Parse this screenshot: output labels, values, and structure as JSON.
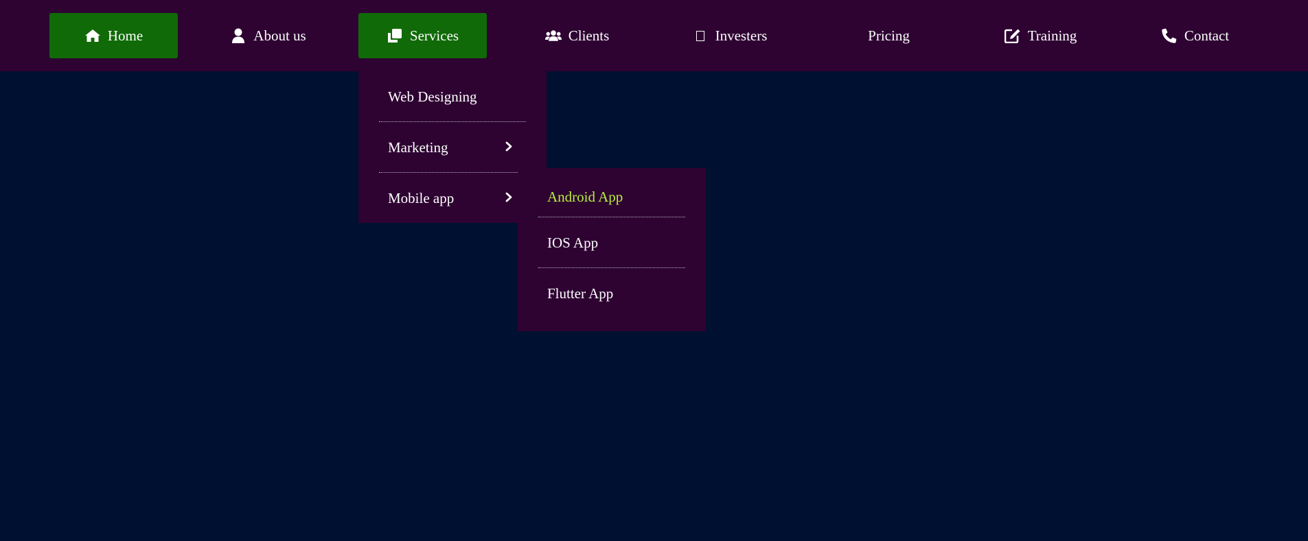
{
  "nav": {
    "items": [
      {
        "label": "Home",
        "icon": "home-icon",
        "active": true
      },
      {
        "label": "About us",
        "icon": "user-icon",
        "active": false
      },
      {
        "label": "Services",
        "icon": "clone-icon",
        "active": true
      },
      {
        "label": "Clients",
        "icon": "users-icon",
        "active": false
      },
      {
        "label": "Investers",
        "icon": "box-icon",
        "active": false
      },
      {
        "label": "Pricing",
        "icon": "",
        "active": false
      },
      {
        "label": "Training",
        "icon": "edit-icon",
        "active": false
      },
      {
        "label": "Contact",
        "icon": "phone-icon",
        "active": false
      }
    ]
  },
  "services_menu": {
    "items": [
      {
        "label": "Web Designing"
      },
      {
        "label": "Marketing"
      },
      {
        "label": "Mobile app"
      }
    ]
  },
  "mobile_submenu": {
    "items": [
      {
        "label": "Android App"
      },
      {
        "label": "IOS App"
      },
      {
        "label": "Flutter App"
      }
    ]
  },
  "colors": {
    "background": "#001030",
    "navbar": "#2e0332",
    "active": "#106a07",
    "highlight_text": "#b8f03c"
  }
}
